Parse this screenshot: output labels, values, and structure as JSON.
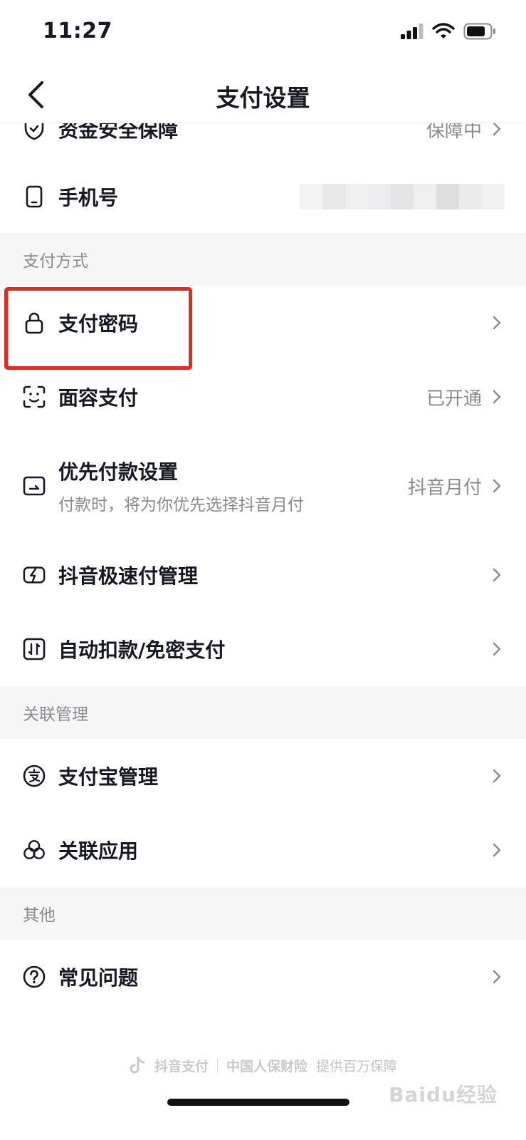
{
  "status": {
    "time": "11:27"
  },
  "nav": {
    "title": "支付设置"
  },
  "rows_top": [
    {
      "label": "资金安全保障",
      "value": "保障中",
      "icon": "shield-icon"
    },
    {
      "label": "手机号",
      "icon": "phone-icon"
    }
  ],
  "section_payment": {
    "header": "支付方式",
    "password": {
      "label": "支付密码"
    },
    "face": {
      "label": "面容支付",
      "value": "已开通"
    },
    "priority": {
      "label": "优先付款设置",
      "sub": "付款时，将为你优先选择抖音月付",
      "value": "抖音月付"
    },
    "fastpay": {
      "label": "抖音极速付管理"
    },
    "autopay": {
      "label": "自动扣款/免密支付"
    }
  },
  "section_linked": {
    "header": "关联管理",
    "alipay": {
      "label": "支付宝管理"
    },
    "apps": {
      "label": "关联应用"
    }
  },
  "section_other": {
    "header": "其他",
    "faq": {
      "label": "常见问题"
    }
  },
  "footer": {
    "brand": "抖音支付",
    "partner": "中国人保财险",
    "guarantee": "提供百万保障"
  },
  "watermark": "Baidu经验",
  "colors": {
    "highlight": "#e8271d",
    "section_bg": "#f6f6f7",
    "secondary_text": "#8a8b91"
  }
}
